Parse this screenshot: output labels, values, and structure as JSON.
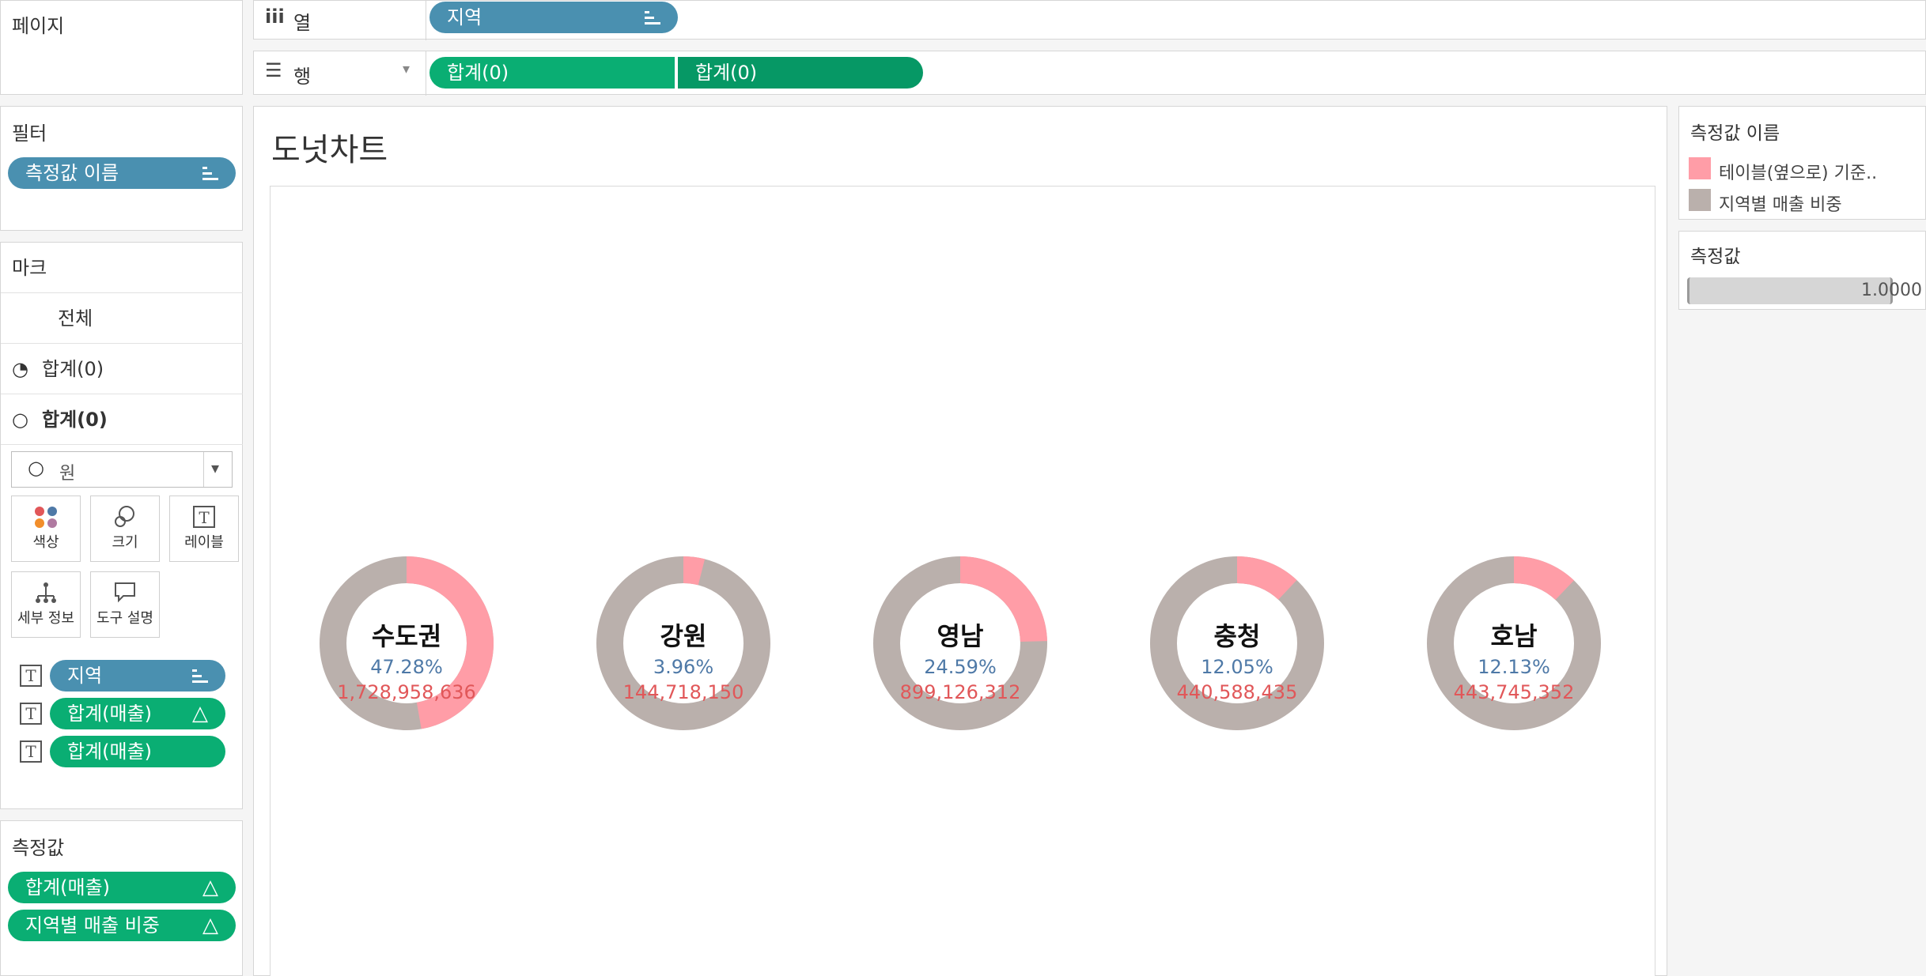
{
  "pages_shelf": {
    "title": "페이지"
  },
  "columns_shelf": {
    "label": "열",
    "pills": [
      {
        "label": "지역"
      }
    ]
  },
  "rows_shelf": {
    "label": "행",
    "pills": [
      {
        "label": "합계(0)"
      },
      {
        "label": "합계(0)"
      }
    ]
  },
  "filters": {
    "title": "필터",
    "pills": [
      {
        "label": "측정값 이름"
      }
    ]
  },
  "marks": {
    "title": "마크",
    "all_label": "전체",
    "layers": [
      {
        "label": "합계(0)"
      },
      {
        "label": "합계(0)"
      }
    ],
    "mark_type": "원",
    "cards": [
      {
        "label": "색상",
        "icon": "color-dots-icon"
      },
      {
        "label": "크기",
        "icon": "size-circles-icon"
      },
      {
        "label": "레이블",
        "icon": "text-label-icon"
      },
      {
        "label": "세부 정보",
        "icon": "detail-tree-icon"
      },
      {
        "label": "도구 설명",
        "icon": "tooltip-speech-icon"
      }
    ],
    "fields": [
      {
        "label": "지역"
      },
      {
        "label": "합계(매출)"
      },
      {
        "label": "합계(매출)"
      }
    ]
  },
  "measure_values": {
    "title": "측정값",
    "pills": [
      {
        "label": "합계(매출)"
      },
      {
        "label": "지역별 매출 비중"
      }
    ]
  },
  "view": {
    "title": "도넛차트"
  },
  "legend": {
    "title": "측정값 이름",
    "items": [
      {
        "label": "테이블(옆으로) 기준..",
        "color": "#ff9da7"
      },
      {
        "label": "지역별 매출 비중",
        "color": "#bab0ac"
      }
    ]
  },
  "size_legend": {
    "title": "측정값",
    "value": "1.0000"
  },
  "colors": {
    "share": "#ff9da7",
    "rest": "#bab0ac",
    "pct_text": "#4e79a7",
    "value_text": "#e15759",
    "pill_blue": "#4a90b0",
    "pill_green": "#0aae73"
  },
  "chart_data": {
    "type": "pie",
    "title": "도넛차트",
    "categories": [
      "수도권",
      "강원",
      "영남",
      "충청",
      "호남"
    ],
    "share_pct": [
      47.28,
      3.96,
      24.59,
      12.05,
      12.13
    ],
    "pct_labels": [
      "47.28%",
      "3.96%",
      "24.59%",
      "12.05%",
      "12.13%"
    ],
    "values": [
      1728958636,
      144718150,
      899126312,
      440588435,
      443745352
    ],
    "value_labels": [
      "1,728,958,636",
      "144,718,150",
      "899,126,312",
      "440,588,435",
      "443,745,352"
    ]
  }
}
